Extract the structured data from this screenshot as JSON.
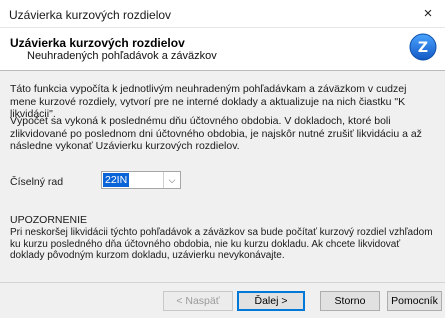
{
  "window": {
    "title": "Uzávierka kurzových rozdielov",
    "close_glyph": "×"
  },
  "header": {
    "title": "Uzávierka kurzových rozdielov",
    "subtitle": "Neuhradených pohľadávok a záväzkov",
    "logo_icon": "wizard-logo-icon",
    "logo_glyph": "Z"
  },
  "content": {
    "paragraph1": "Táto funkcia vypočíta k jednotlivým neuhradeným pohľadávkam a záväzkom v cudzej mene kurzové rozdiely, vytvorí pre ne interné doklady a aktualizuje na nich čiastku \"K likvidácii\".",
    "paragraph2": "Výpočet sa vykoná k poslednému dňu účtovného obdobia. V dokladoch, ktoré boli zlikvidované po poslednom dni účtovného obdobia, je najskôr nutné zrušiť likvidáciu a až následne vykonať Uzávierku kurzových rozdielov.",
    "series_label": "Číselný rad",
    "series_value": "22IN",
    "warning_title": "UPOZORNENIE",
    "warning_text": "Pri neskoršej likvidácii týchto pohľadávok a záväzkov sa bude počítať kurzový rozdiel vzhľadom ku kurzu posledného dňa účtovného obdobia, nie ku kurzu dokladu. Ak chcete likvidovať doklady pôvodným kurzom dokladu, uzávierku nevykonávajte."
  },
  "buttons": {
    "back": "< Naspäť",
    "next": "Ďalej >",
    "cancel": "Storno",
    "help": "Pomocník"
  },
  "colors": {
    "accent": "#0a64d8",
    "logo": "#1a73d9"
  }
}
